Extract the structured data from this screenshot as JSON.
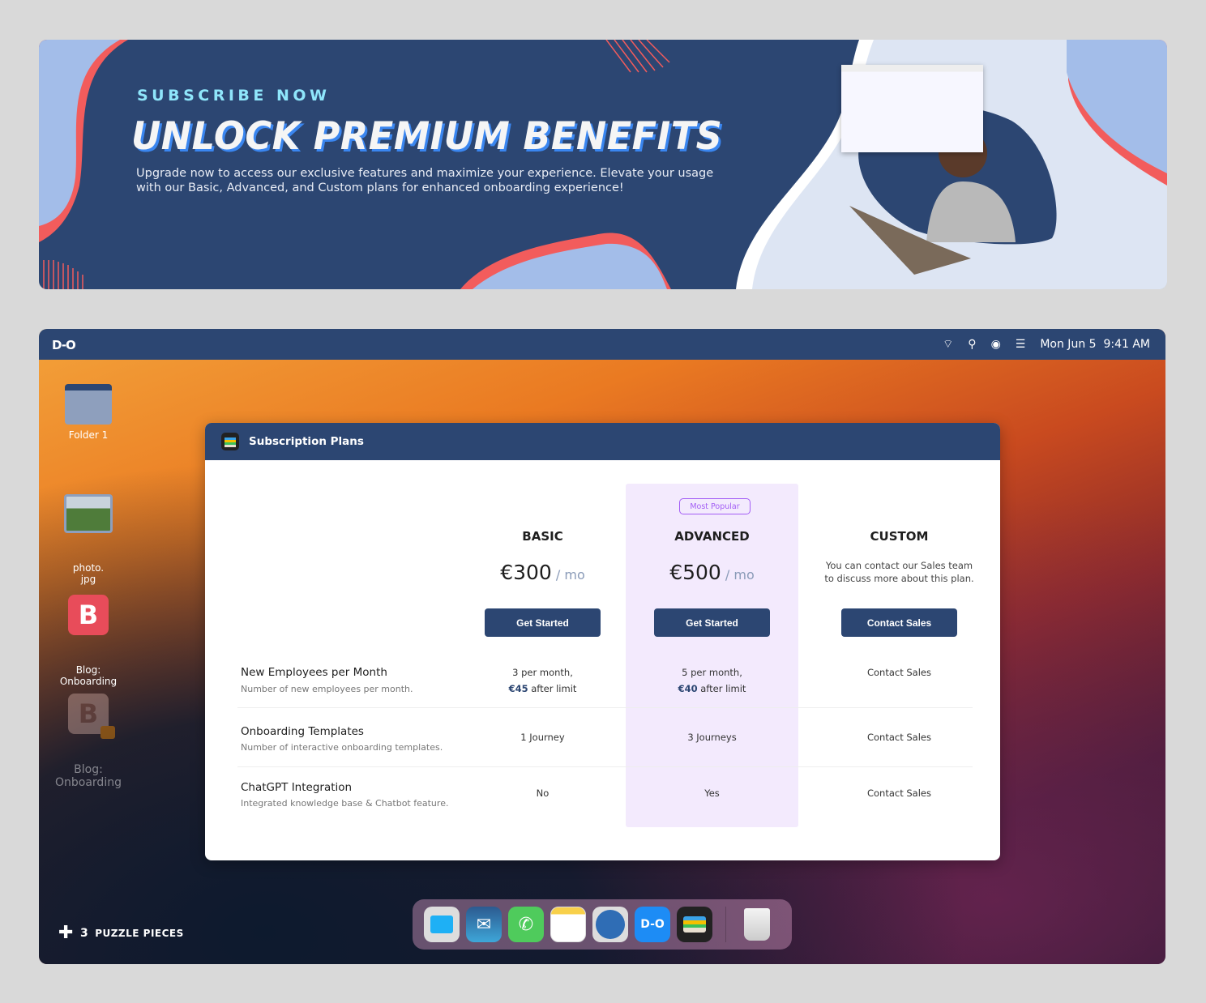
{
  "banner": {
    "eyebrow": "SUBSCRIBE NOW",
    "headline": "UNLOCK PREMIUM BENEFITS",
    "description": "Upgrade now to access our exclusive features and maximize your experience. Elevate your usage with our Basic, Advanced, and Custom plans for enhanced onboarding experience!"
  },
  "menubar": {
    "logo": "D-O",
    "datetime": "Mon Jun 5  9:41 AM"
  },
  "desktop_icons": [
    {
      "label": "Folder 1"
    },
    {
      "label": "photo.\njpg"
    },
    {
      "label": "Blog:\nOnboarding"
    },
    {
      "label": "Blog:\nOnboarding",
      "locked": true
    }
  ],
  "window": {
    "title": "Subscription Plans"
  },
  "plans": [
    {
      "name": "BASIC",
      "price": "€300",
      "period": " / mo",
      "button": "Get Started"
    },
    {
      "name": "ADVANCED",
      "price": "€500",
      "period": " / mo",
      "button": "Get Started",
      "badge": "Most Popular"
    },
    {
      "name": "CUSTOM",
      "description": "You can contact our Sales team to discuss more about this plan.",
      "button": "Contact Sales"
    }
  ],
  "features": [
    {
      "title": "New Employees per Month",
      "subtitle": "Number of new employees per month.",
      "basic_line1": "3 per month,",
      "basic_amount": "€45",
      "basic_suffix": " after limit",
      "advanced_line1": "5 per month,",
      "advanced_amount": "€40",
      "advanced_suffix": " after limit",
      "custom": "Contact Sales"
    },
    {
      "title": "Onboarding Templates",
      "subtitle": "Number of interactive onboarding templates.",
      "basic": "1 Journey",
      "advanced": "3 Journeys",
      "custom": "Contact Sales"
    },
    {
      "title": "ChatGPT Integration",
      "subtitle": "Integrated knowledge base & Chatbot feature.",
      "basic": "No",
      "advanced": "Yes",
      "custom": "Contact Sales"
    }
  ],
  "footer": {
    "count": "3",
    "label": "PUZZLE PIECES"
  },
  "colors": {
    "brand": "#2c4672",
    "highlight": "#f3eafd",
    "badge": "#a35ef5",
    "coral": "#f25c5c",
    "lightblue": "#a3bde9"
  }
}
